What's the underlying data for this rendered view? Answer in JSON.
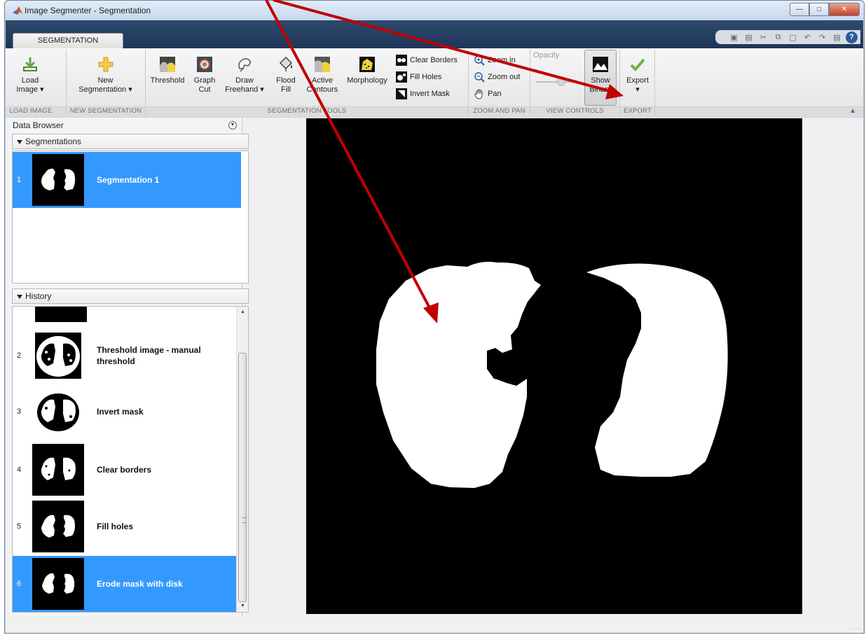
{
  "window": {
    "title": "Image Segmenter - Segmentation"
  },
  "tabs": {
    "segmentation": "SEGMENTATION"
  },
  "ribbon": {
    "load_image": {
      "line1": "Load",
      "line2": "Image ▾"
    },
    "new_segmentation": {
      "line1": "New",
      "line2": "Segmentation ▾"
    },
    "threshold": "Threshold",
    "graph_cut": {
      "line1": "Graph",
      "line2": "Cut"
    },
    "draw_freehand": {
      "line1": "Draw",
      "line2": "Freehand ▾"
    },
    "flood_fill": {
      "line1": "Flood",
      "line2": "Fill"
    },
    "active_contours": {
      "line1": "Active",
      "line2": "Contours"
    },
    "morphology": "Morphology",
    "clear_borders": "Clear Borders",
    "fill_holes": "Fill Holes",
    "invert_mask": "Invert Mask",
    "zoom_in": "Zoom in",
    "zoom_out": "Zoom out",
    "pan": "Pan",
    "opacity": "Opacity",
    "show_binary": {
      "line1": "Show",
      "line2": "Binary"
    },
    "export": {
      "line1": "Export",
      "line2": "▾"
    },
    "groups": {
      "load_image": "LOAD IMAGE",
      "new_segmentation": "NEW SEGMENTATION",
      "segmentation_tools": "SEGMENTATION TOOLS",
      "zoom_and_pan": "ZOOM AND PAN",
      "view_controls": "VIEW CONTROLS",
      "export": "EXPORT"
    }
  },
  "browser": {
    "title": "Data Browser",
    "segmentations_header": "Segmentations",
    "history_header": "History",
    "segmentations": [
      {
        "num": "1",
        "label": "Segmentation 1"
      }
    ],
    "history": [
      {
        "num": "2",
        "label": "Threshold image - manual threshold"
      },
      {
        "num": "3",
        "label": "Invert mask"
      },
      {
        "num": "4",
        "label": "Clear borders"
      },
      {
        "num": "5",
        "label": "Fill holes"
      },
      {
        "num": "6",
        "label": "Erode mask with disk"
      }
    ]
  },
  "colors": {
    "selection": "#3399ff",
    "annotation_arrow": "#c00000",
    "tabstrip": "#1d3557"
  }
}
